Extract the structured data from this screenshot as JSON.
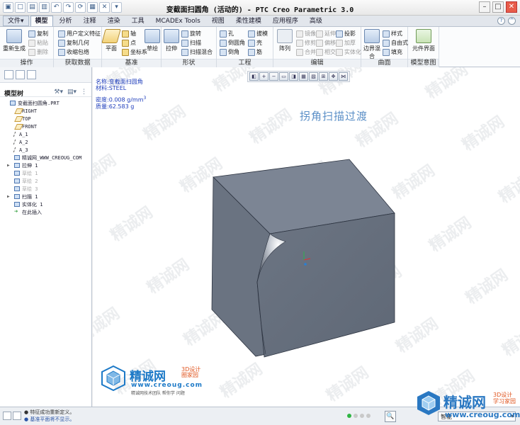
{
  "window": {
    "title": "变截面扫圆角 (活动的) - PTC Creo Parametric 3.0"
  },
  "tabs": [
    {
      "label": "文件▾",
      "kind": "file"
    },
    {
      "label": "模型",
      "kind": "active"
    },
    {
      "label": "分析",
      "kind": ""
    },
    {
      "label": "注释",
      "kind": ""
    },
    {
      "label": "渲染",
      "kind": ""
    },
    {
      "label": "工具",
      "kind": ""
    },
    {
      "label": "MCADEx Tools",
      "kind": ""
    },
    {
      "label": "视图",
      "kind": ""
    },
    {
      "label": "柔性建模",
      "kind": ""
    },
    {
      "label": "应用程序",
      "kind": ""
    },
    {
      "label": "高级",
      "kind": ""
    }
  ],
  "ribbon": {
    "operations": {
      "label": "操作",
      "regenerate": "重新生成",
      "copy": "复制",
      "paste": "粘贴",
      "delete": "删除"
    },
    "get_data": {
      "label": "获取数据",
      "udf": "用户定义特征",
      "copy_geom": "复制几何",
      "shrinkwrap": "收缩包络"
    },
    "datum": {
      "label": "基准",
      "plane": "平面",
      "axis": "轴",
      "point": "点",
      "csys": "坐标系",
      "sketch": "草绘"
    },
    "shapes": {
      "label": "形状",
      "extrude": "拉伸",
      "revolve": "旋转",
      "sweep": "扫描",
      "swept_blend": "扫描混合"
    },
    "engineering": {
      "label": "工程",
      "hole": "孔",
      "round": "倒圆角",
      "chamfer": "倒角",
      "draft": "拔模",
      "shell": "壳",
      "rib": "筋"
    },
    "editing": {
      "label": "编辑",
      "pattern": "阵列",
      "mirror": "镜像",
      "extend": "延伸",
      "project": "投影",
      "trim": "修剪",
      "offset": "偏移",
      "thicken": "加厚",
      "merge": "合并",
      "intersect": "相交",
      "solidify": "实体化"
    },
    "surfaces": {
      "label": "曲面",
      "boundary_blend": "边界混合",
      "style": "样式",
      "freestyle": "自由式",
      "fill": "填充"
    },
    "model_intent": {
      "label": "模型意图",
      "component_interface": "元件界面"
    }
  },
  "model_tree": {
    "header": "模型树",
    "items": [
      {
        "label": "变截面扫圆角.PRT",
        "icon": "part-icon",
        "indent": 0,
        "dim": false,
        "expander": ""
      },
      {
        "label": "RIGHT",
        "icon": "plane",
        "indent": 1,
        "dim": false,
        "expander": ""
      },
      {
        "label": "TOP",
        "icon": "plane",
        "indent": 1,
        "dim": false,
        "expander": ""
      },
      {
        "label": "FRONT",
        "icon": "plane",
        "indent": 1,
        "dim": false,
        "expander": ""
      },
      {
        "label": "A_1",
        "icon": "axis",
        "indent": 1,
        "dim": false,
        "expander": ""
      },
      {
        "label": "A_2",
        "icon": "axis",
        "indent": 1,
        "dim": false,
        "expander": ""
      },
      {
        "label": "A_3",
        "icon": "axis",
        "indent": 1,
        "dim": false,
        "expander": ""
      },
      {
        "label": "精诚网_WWW_CREOUG_COM",
        "icon": "csys",
        "indent": 1,
        "dim": false,
        "expander": ""
      },
      {
        "label": "拉伸 1",
        "icon": "feat",
        "indent": 1,
        "dim": false,
        "expander": "▶"
      },
      {
        "label": "草绘 1",
        "icon": "sketch",
        "indent": 1,
        "dim": true,
        "expander": ""
      },
      {
        "label": "草绘 2",
        "icon": "sketch",
        "indent": 1,
        "dim": true,
        "expander": ""
      },
      {
        "label": "草绘 3",
        "icon": "sketch",
        "indent": 1,
        "dim": true,
        "expander": ""
      },
      {
        "label": "扫描 1",
        "icon": "feat",
        "indent": 1,
        "dim": false,
        "expander": "▶"
      },
      {
        "label": "实体化 1",
        "icon": "feat",
        "indent": 1,
        "dim": false,
        "expander": ""
      },
      {
        "label": "在此插入",
        "icon": "arrow",
        "indent": 1,
        "dim": false,
        "expander": ""
      }
    ]
  },
  "graphics": {
    "info_name": "名称:变截面扫圆角",
    "info_material": "材料:STEEL",
    "info_density": "密度:0.008 g/mm",
    "info_density_exp": "3",
    "info_mass": "质量:62.583 g",
    "caption": "拐角扫描过渡"
  },
  "logo_left": {
    "brand": "精诚网",
    "tag": "3D设计 圈家园",
    "site": "www.creoug.com",
    "slogan": "精诚网技术团队 帮你学 问题"
  },
  "logo_right": {
    "brand": "精诚网",
    "tag": "3D设计 学习家园",
    "site": "www.creoug.com"
  },
  "status": {
    "msg1": "● 特征成功重新定义。",
    "msg2": "● 基准平面将不显示。",
    "find_label": "🔍",
    "filter_value": "智能"
  },
  "colors": {
    "cube_face": "#6e7785",
    "accent": "#1c79c7",
    "info_text": "#1d3cbb"
  }
}
